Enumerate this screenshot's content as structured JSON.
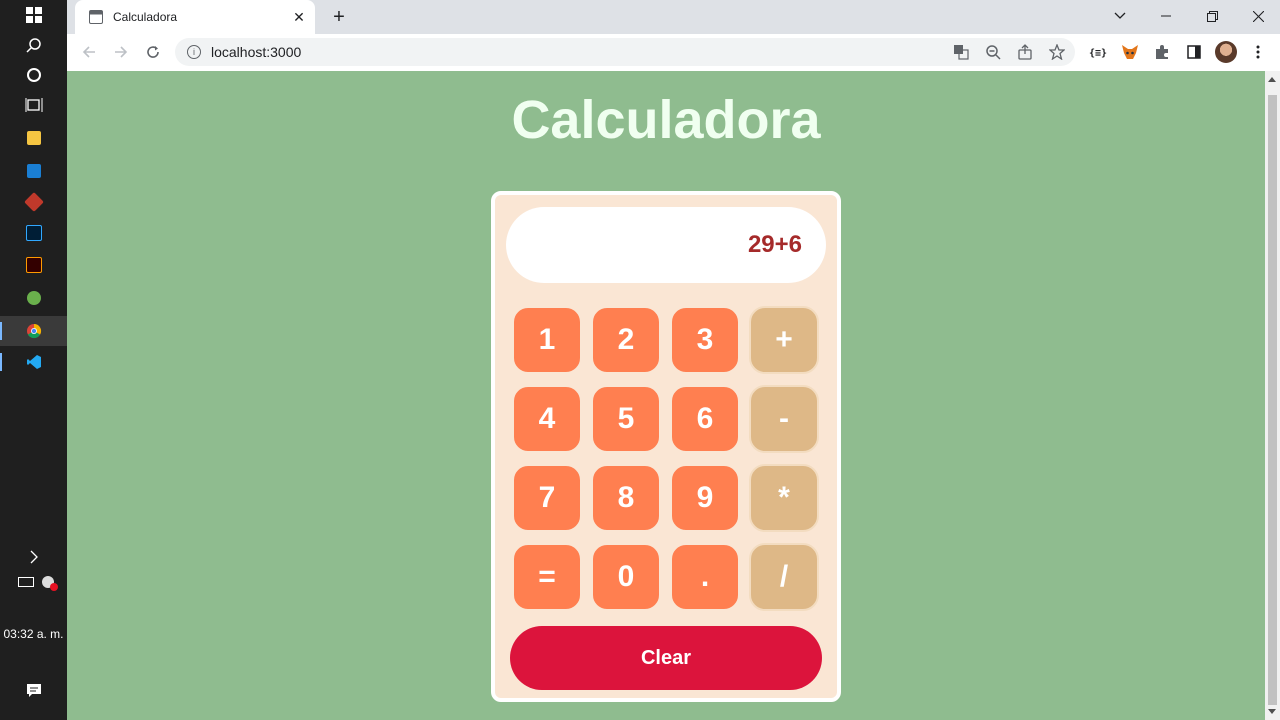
{
  "taskbar": {
    "clock": "03:32 a. m."
  },
  "browser": {
    "tab_title": "Calculadora",
    "tab_close": "✕",
    "new_tab": "+",
    "url": "localhost:3000"
  },
  "page": {
    "title": "Calculadora",
    "display_value": "29+6",
    "keys": [
      "1",
      "2",
      "3",
      "+",
      "4",
      "5",
      "6",
      "-",
      "7",
      "8",
      "9",
      "*",
      "=",
      "0",
      ".",
      "/"
    ],
    "clear_label": "Clear"
  },
  "colors": {
    "page_background": "#8fbc8f",
    "number_key": "#ff7f50",
    "operator_key": "#deb887",
    "clear_button": "#dc143c",
    "display_text": "#a52a2a",
    "panel": "#fae6d4"
  }
}
